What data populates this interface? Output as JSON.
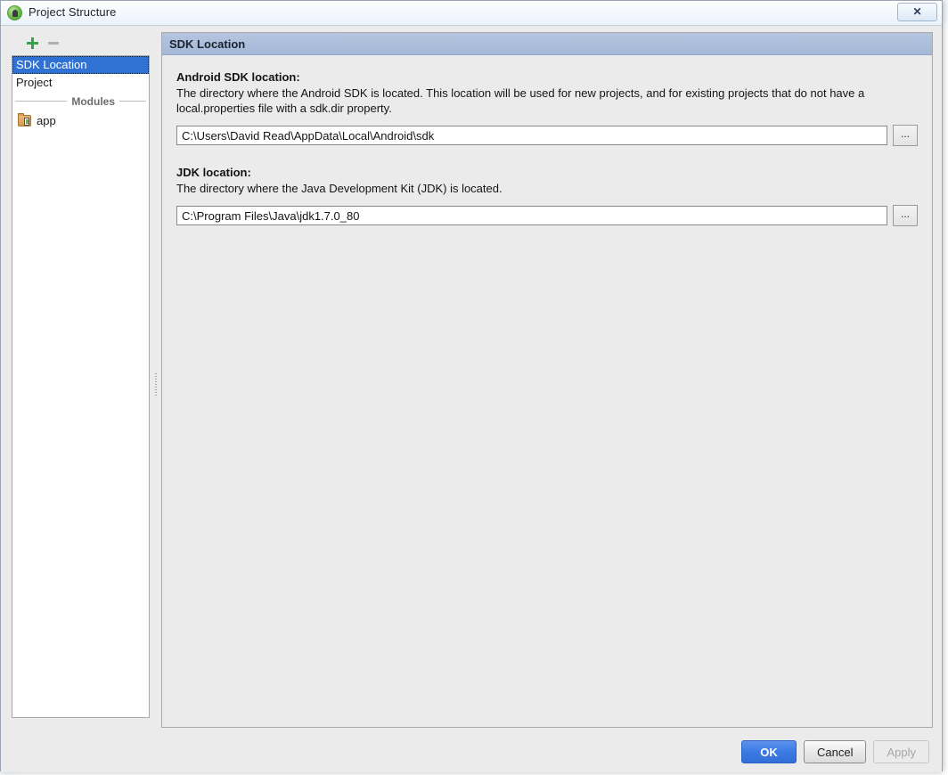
{
  "window": {
    "title": "Project Structure",
    "app_icon": "android-studio-icon",
    "close_label": "✕"
  },
  "sidebar": {
    "toolbar": {
      "add_label": "+",
      "remove_label": "−"
    },
    "items": [
      {
        "label": "SDK Location",
        "selected": true
      },
      {
        "label": "Project",
        "selected": false
      }
    ],
    "group_separator": "Modules",
    "modules": [
      {
        "label": "app",
        "icon": "module-folder-icon"
      }
    ]
  },
  "main": {
    "header_title": "SDK Location",
    "fields": [
      {
        "label": "Android SDK location:",
        "description": "The directory where the Android SDK is located. This location will be used for new projects, and for existing projects that do not have a local.properties file with a sdk.dir property.",
        "value": "C:\\Users\\David Read\\AppData\\Local\\Android\\sdk",
        "placeholder": "",
        "browse_label": "..."
      },
      {
        "label": "JDK location:",
        "description": "The directory where the Java Development Kit (JDK) is located.",
        "value": "C:\\Program Files\\Java\\jdk1.7.0_80",
        "placeholder": "",
        "browse_label": "..."
      }
    ]
  },
  "buttons": {
    "ok": "OK",
    "cancel": "Cancel",
    "apply": "Apply"
  },
  "colors": {
    "accent_blue": "#336fd8",
    "selection_blue": "#2f72d4",
    "header_blue": "#a5b8d8",
    "dialog_bg": "#ebebeb",
    "module_green": "#5fbb45"
  }
}
